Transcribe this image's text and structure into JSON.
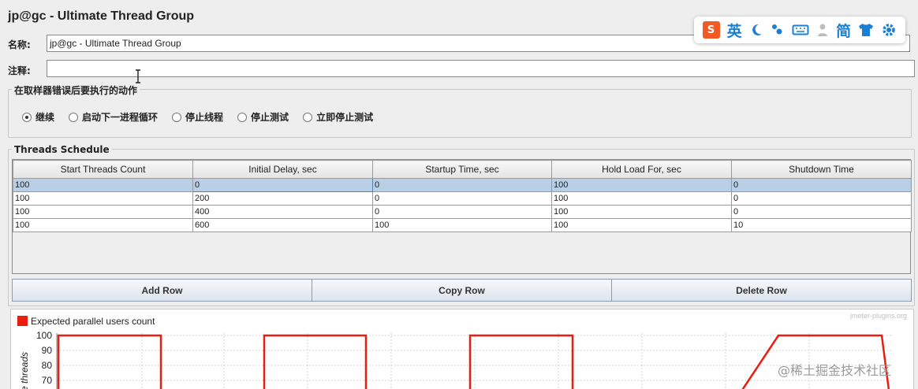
{
  "window": {
    "title": "jp@gc - Ultimate Thread Group"
  },
  "fields": {
    "name_label": "名称:",
    "name_value": "jp@gc - Ultimate Thread Group",
    "comment_label": "注释:",
    "comment_value": ""
  },
  "ime_toolbar": {
    "logo": "S",
    "lang": "英",
    "mode": "简",
    "icons": [
      "sogou-logo-icon",
      "moon-icon",
      "punctuation-icon",
      "keyboard-icon",
      "user-icon",
      "shirt-icon",
      "gear-icon"
    ]
  },
  "sampler_error": {
    "title": "在取样器错误后要执行的动作",
    "options": [
      {
        "label": "继续",
        "checked": true
      },
      {
        "label": "启动下一进程循环",
        "checked": false
      },
      {
        "label": "停止线程",
        "checked": false
      },
      {
        "label": "停止测试",
        "checked": false
      },
      {
        "label": "立即停止测试",
        "checked": false
      }
    ]
  },
  "schedule": {
    "title": "Threads Schedule",
    "columns": [
      "Start Threads Count",
      "Initial Delay, sec",
      "Startup Time, sec",
      "Hold Load For, sec",
      "Shutdown Time"
    ],
    "rows": [
      [
        "100",
        "0",
        "0",
        "100",
        "0"
      ],
      [
        "100",
        "200",
        "0",
        "100",
        "0"
      ],
      [
        "100",
        "400",
        "0",
        "100",
        "0"
      ],
      [
        "100",
        "600",
        "100",
        "100",
        "10"
      ]
    ],
    "selected_row": 0
  },
  "buttons": {
    "add": "Add Row",
    "copy": "Copy Row",
    "delete": "Delete Row"
  },
  "chart": {
    "legend": "Expected parallel users count",
    "brand": "jmeter-plugins.org",
    "ylabel": "Number of active threads",
    "ylabel_visible": "e threads",
    "y_ticks": [
      "100",
      "90",
      "80",
      "70"
    ],
    "line_color": "#e81f10"
  },
  "watermark": "@稀土掘金技术社区",
  "chart_data": {
    "type": "line",
    "series": [
      {
        "name": "Expected parallel users count",
        "values": [
          100,
          100,
          100,
          100
        ]
      }
    ],
    "ylim": [
      70,
      100
    ],
    "grid": true,
    "legend": "top-left"
  }
}
